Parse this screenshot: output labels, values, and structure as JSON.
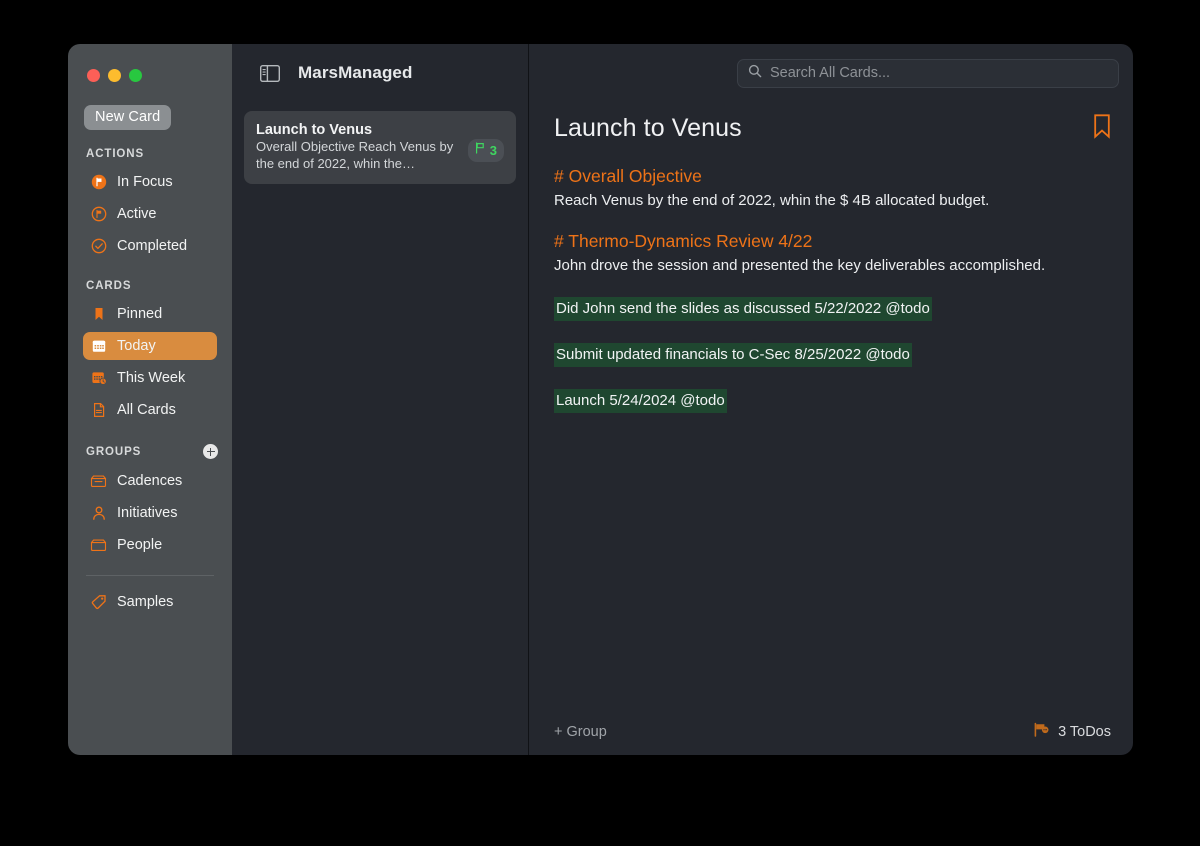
{
  "window": {
    "traffic_lights": [
      "close",
      "minimize",
      "maximize"
    ],
    "colors": {
      "sidebar_bg": "#4a4e51",
      "content_bg": "#24272e",
      "accent_orange": "#ee7318",
      "selected_orange": "#d98c3f",
      "todo_green_bg": "#1f4730",
      "badge_green": "#3fd660"
    }
  },
  "sidebar": {
    "new_card_label": "New Card",
    "sections": [
      {
        "label": "ACTIONS",
        "items": [
          {
            "label": "In Focus",
            "icon": "flag-filled-circle-icon",
            "selected": false
          },
          {
            "label": "Active",
            "icon": "flag-outline-circle-icon",
            "selected": false
          },
          {
            "label": "Completed",
            "icon": "check-circle-icon",
            "selected": false
          }
        ]
      },
      {
        "label": "CARDS",
        "items": [
          {
            "label": "Pinned",
            "icon": "bookmark-icon",
            "selected": false
          },
          {
            "label": "Today",
            "icon": "calendar-icon",
            "selected": true
          },
          {
            "label": "This Week",
            "icon": "calendar-clock-icon",
            "selected": false
          },
          {
            "label": "All Cards",
            "icon": "document-icon",
            "selected": false
          }
        ]
      },
      {
        "label": "GROUPS",
        "add_button": "add-group-icon",
        "items": [
          {
            "label": "Cadences",
            "icon": "inbox-tray-icon",
            "selected": false
          },
          {
            "label": "Initiatives",
            "icon": "person-icon",
            "selected": false
          },
          {
            "label": "People",
            "icon": "inbox-open-icon",
            "selected": false
          }
        ]
      },
      {
        "label": "",
        "items": [
          {
            "label": "Samples",
            "icon": "tag-icon",
            "selected": false
          }
        ]
      }
    ]
  },
  "toolbar": {
    "sidebar_toggle_icon": "sidebar-toggle-icon",
    "app_title": "MarsManaged",
    "search": {
      "icon": "search-icon",
      "value": "",
      "placeholder": "Search All Cards..."
    }
  },
  "card_list": [
    {
      "title": "Launch to Venus",
      "snippet": "Overall Objective Reach Venus by the end of 2022, whin the…",
      "badge_icon": "flag-icon",
      "badge_count": "3",
      "selected": true
    }
  ],
  "detail": {
    "title": "Launch to Venus",
    "bookmark_icon": "bookmark-icon",
    "blocks": [
      {
        "type": "heading",
        "text": "# Overall Objective"
      },
      {
        "type": "body",
        "text": "Reach Venus by the end of 2022, whin the $ 4B allocated budget."
      },
      {
        "type": "heading",
        "text": "# Thermo-Dynamics Review 4/22"
      },
      {
        "type": "body",
        "text": "John drove the session and presented the key deliverables accomplished."
      },
      {
        "type": "todo",
        "text": "Did John send the slides as discussed 5/22/2022 @todo"
      },
      {
        "type": "todo",
        "text": "Submit updated financials to C-Sec 8/25/2022 @todo"
      },
      {
        "type": "todo",
        "text": "Launch 5/24/2024 @todo"
      }
    ],
    "footer": {
      "add_group_label": "+ Group",
      "todo_icon": "flag-badge-icon",
      "todo_count_label": "3 ToDos"
    }
  }
}
